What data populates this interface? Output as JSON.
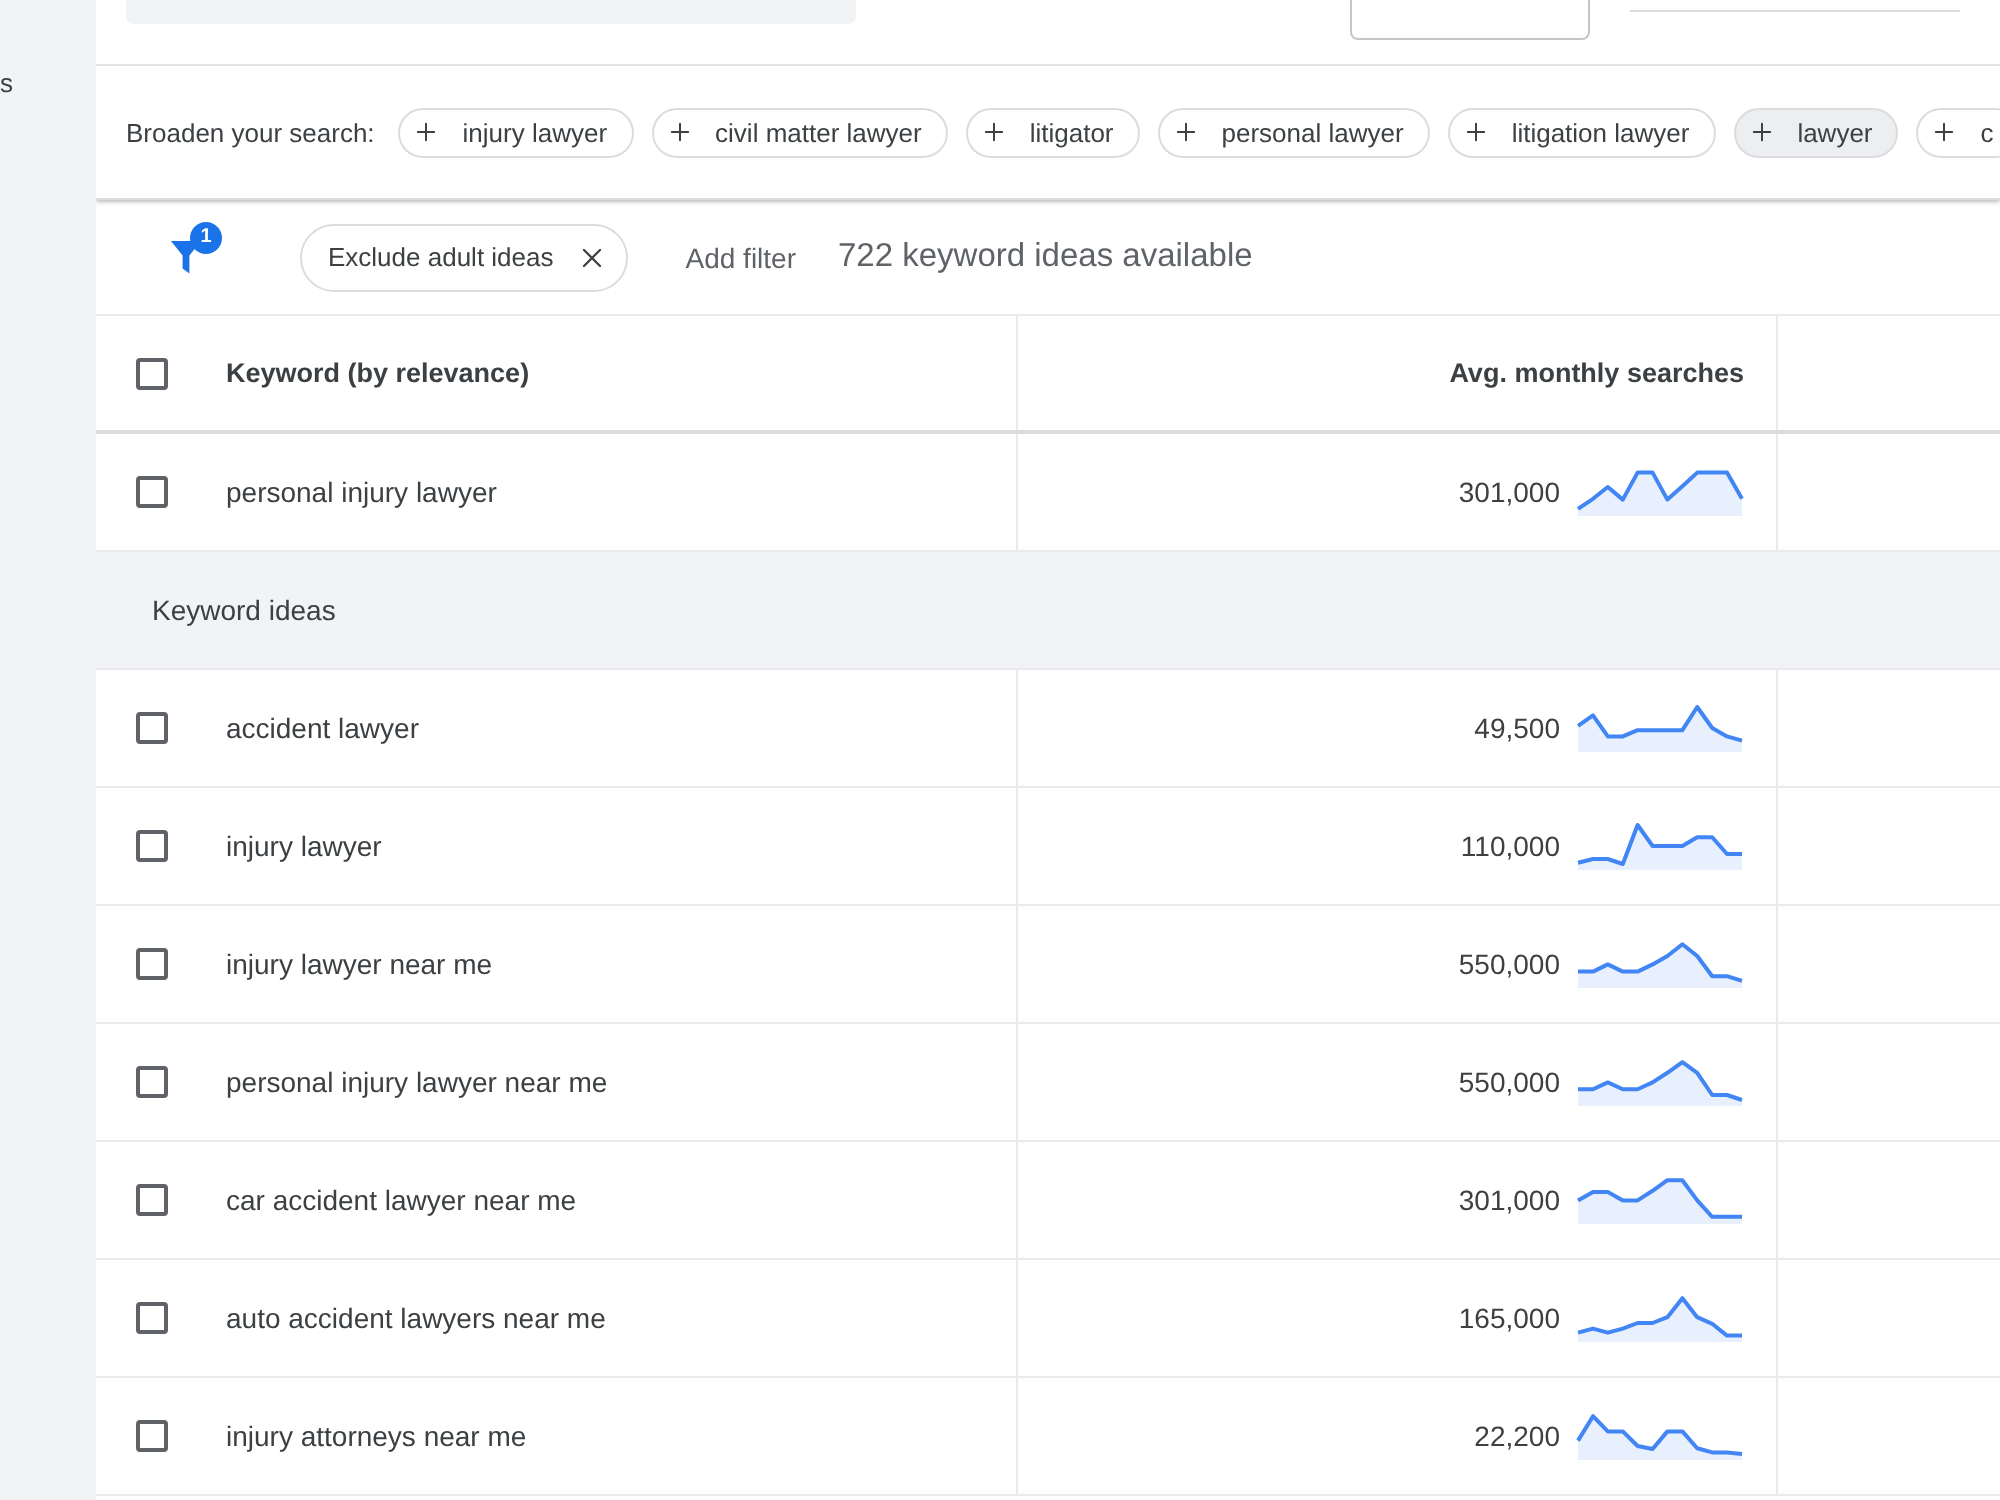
{
  "sidebar": {
    "items": [
      {
        "label": "s"
      }
    ]
  },
  "broaden_search": {
    "label": "Broaden your search:",
    "chips": [
      {
        "label": "injury lawyer",
        "selected": false
      },
      {
        "label": "civil matter lawyer",
        "selected": false
      },
      {
        "label": "litigator",
        "selected": false
      },
      {
        "label": "personal lawyer",
        "selected": false
      },
      {
        "label": "litigation lawyer",
        "selected": false
      },
      {
        "label": "lawyer",
        "selected": true
      },
      {
        "label": "c",
        "selected": false
      }
    ]
  },
  "filter_bar": {
    "filter_count": "1",
    "filters": [
      {
        "label": "Exclude adult ideas"
      }
    ],
    "add_filter": "Add filter",
    "summary": "722 keyword ideas available"
  },
  "table": {
    "columns": [
      {
        "label": "Keyword (by relevance)"
      },
      {
        "label": "Avg. monthly searches"
      }
    ],
    "select_all": {
      "checked": false
    },
    "rows": [
      {
        "kind": "keyword",
        "keyword": "personal injury lawyer",
        "avg_monthly_searches": "301,000",
        "checked": false
      },
      {
        "kind": "group",
        "label": "Keyword ideas"
      },
      {
        "kind": "keyword",
        "keyword": "accident lawyer",
        "avg_monthly_searches": "49,500",
        "checked": false
      },
      {
        "kind": "keyword",
        "keyword": "injury lawyer",
        "avg_monthly_searches": "110,000",
        "checked": false
      },
      {
        "kind": "keyword",
        "keyword": "injury lawyer near me",
        "avg_monthly_searches": "550,000",
        "checked": false
      },
      {
        "kind": "keyword",
        "keyword": "personal injury lawyer near me",
        "avg_monthly_searches": "550,000",
        "checked": false
      },
      {
        "kind": "keyword",
        "keyword": "car accident lawyer near me",
        "avg_monthly_searches": "301,000",
        "checked": false
      },
      {
        "kind": "keyword",
        "keyword": "auto accident lawyers near me",
        "avg_monthly_searches": "165,000",
        "checked": false
      },
      {
        "kind": "keyword",
        "keyword": "injury attorneys near me",
        "avg_monthly_searches": "22,200",
        "checked": false
      }
    ]
  }
}
